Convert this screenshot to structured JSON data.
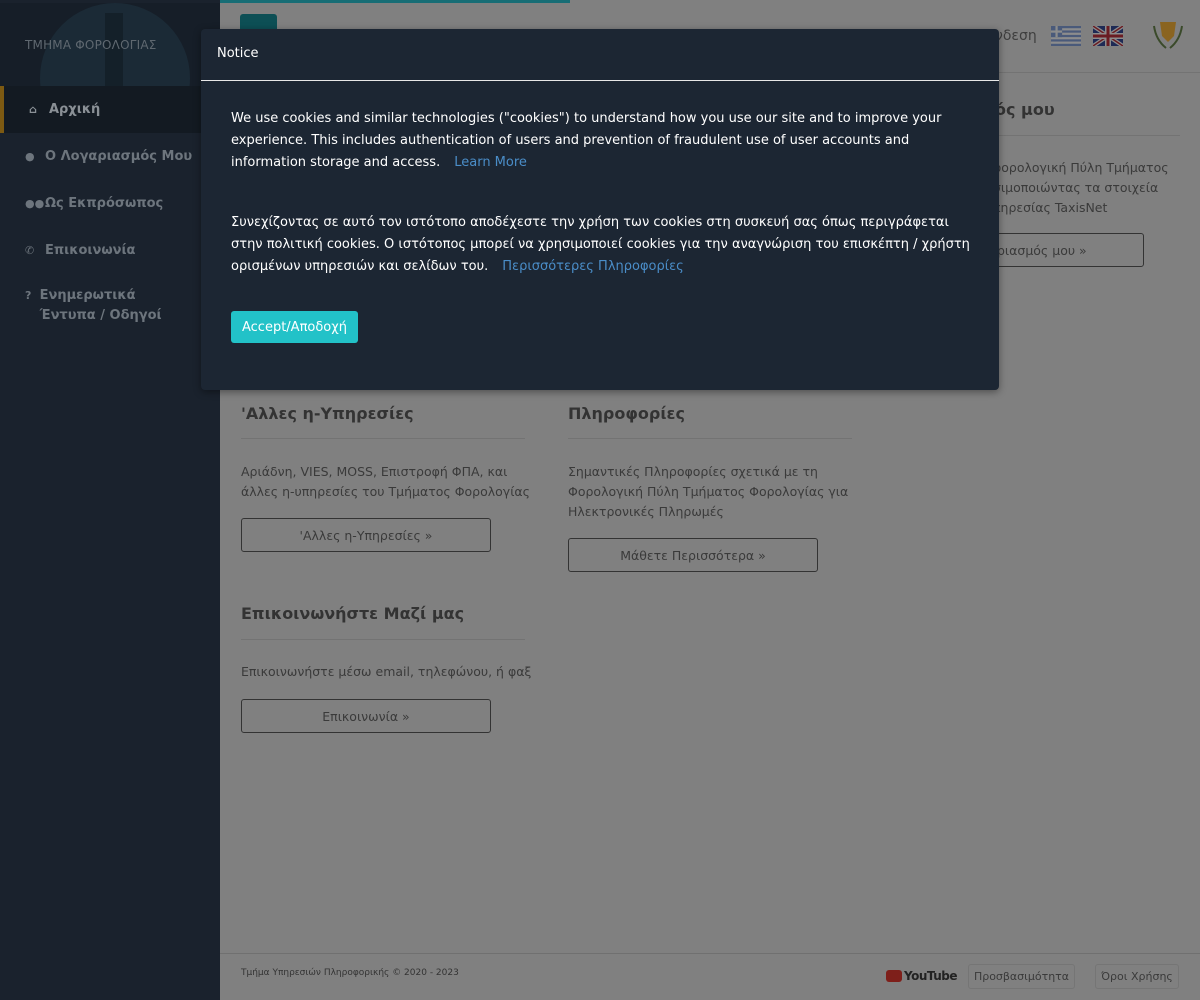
{
  "sidebar": {
    "brand": "ΤΜΗΜΑ ΦΟΡΟΛΟΓΙΑΣ",
    "items": [
      {
        "label": "Αρχική",
        "icon": "home-icon",
        "glyph": "⌂"
      },
      {
        "label": "Ο Λογαριασμός Μου",
        "icon": "user-icon",
        "glyph": "●"
      },
      {
        "label": "Ως Εκπρόσωπος",
        "icon": "users-icon",
        "glyph": "●●"
      },
      {
        "label": "Επικοινωνία",
        "icon": "phone-icon",
        "glyph": "✆"
      },
      {
        "label": "Ενημερωτικά Έντυπα / Οδηγοί",
        "icon": "question-icon",
        "glyph": "?"
      }
    ]
  },
  "header": {
    "login_partial": "νδεση",
    "flags": [
      "greek-flag",
      "uk-flag"
    ]
  },
  "sections": {
    "my_account": {
      "title_partial": "ός μου",
      "text_partial": [
        "φορολογική Πύλη Τμήματος",
        "σιμοποιώντας τα στοιχεία",
        "πηρεσίας TaxisNet"
      ],
      "button_partial": "ριασμός μου »"
    },
    "other_services": {
      "title": "'Αλλες η-Υπηρεσίες",
      "text": "Αριάδνη, VIES, MOSS, Επιστροφή ΦΠΑ, και άλλες η-υπηρεσίες του Τμήματος Φορολογίας",
      "button": "'Αλλες η-Υπηρεσίες »"
    },
    "info": {
      "title": "Πληροφορίες",
      "text": "Σημαντικές Πληροφορίες σχετικά με τη Φορολογική Πύλη Τμήματος Φορολογίας για Ηλεκτρονικές Πληρωμές",
      "button": "Μάθετε Περισσότερα »"
    },
    "contact": {
      "title": "Επικοινωνήστε Μαζί μας",
      "text": "Επικοινωνήστε μέσω email, τηλεφώνου, ή φαξ",
      "button": "Επικοινωνία »"
    }
  },
  "footer": {
    "copyright": "Τμήμα Υπηρεσιών Πληροφορικής © 2020 - 2023",
    "youtube": "YouTube",
    "accessibility": "Προσβασιμότητα",
    "terms": "Όροι Χρήσης"
  },
  "modal": {
    "title": "Notice",
    "p1": "We use cookies and similar technologies (\"cookies\") to understand how you use our site and to improve your experience. This includes authentication of users and prevention of fraudulent use of user accounts and information storage and access.",
    "p1_link": "Learn More",
    "p2": "Συνεχίζοντας σε αυτό τον ιστότοπο αποδέχεστε την χρήση των cookies στη συσκευή σας όπως περιγράφεται στην πολιτική cookies. Ο ιστότοπος μπορεί να χρησιμοποιεί cookies για την αναγνώριση του επισκέπτη / χρήστη ορισμένων υπηρεσιών και σελίδων του.",
    "p2_link": "Περισσότερες Πληροφορίες",
    "accept": "Accept/Αποδοχή"
  },
  "colors": {
    "accent": "#22c2c8",
    "sidebar": "#1a222d",
    "modal": "#1c2633",
    "link": "#4a8dc8"
  }
}
